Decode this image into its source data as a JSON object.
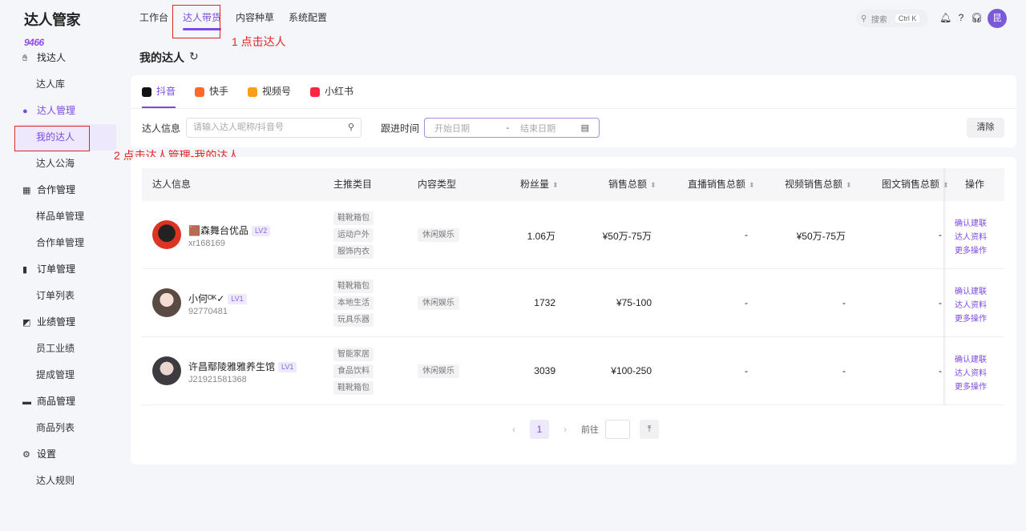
{
  "app": {
    "logo_num": "9466",
    "logo_text": "达人管家"
  },
  "nav": [
    "工作台",
    "达人带货",
    "内容种草",
    "系统配置"
  ],
  "annotations": {
    "step1": "1 点击达人",
    "step2": "2 点击达人管理-我的达人"
  },
  "topbar": {
    "search_label": "搜索",
    "search_kbd": "Ctrl K",
    "avatar": "昆"
  },
  "sidebar": {
    "groups": [
      {
        "label": "找达人",
        "icon": "handshake-icon",
        "items": [
          "达人库"
        ]
      },
      {
        "label": "达人管理",
        "icon": "user-icon",
        "items": [
          "我的达人",
          "达人公海"
        ]
      },
      {
        "label": "合作管理",
        "icon": "grid-icon",
        "items": [
          "样品单管理",
          "合作单管理"
        ]
      },
      {
        "label": "订单管理",
        "icon": "clipboard-icon",
        "items": [
          "订单列表"
        ]
      },
      {
        "label": "业绩管理",
        "icon": "chart-icon",
        "items": [
          "员工业绩",
          "提成管理"
        ]
      },
      {
        "label": "商品管理",
        "icon": "box-icon",
        "items": [
          "商品列表"
        ]
      },
      {
        "label": "设置",
        "icon": "gear-icon",
        "items": [
          "达人规则"
        ]
      }
    ]
  },
  "page": {
    "title": "我的达人"
  },
  "platform_tabs": [
    {
      "label": "抖音",
      "color": "#111111"
    },
    {
      "label": "快手",
      "color": "#ff6a2b"
    },
    {
      "label": "视频号",
      "color": "#fa9d18"
    },
    {
      "label": "小红书",
      "color": "#ff2442"
    }
  ],
  "filters": {
    "info_label": "达人信息",
    "info_placeholder": "请输入达人昵称/抖音号",
    "time_label": "跟进时间",
    "start_placeholder": "开始日期",
    "end_placeholder": "结束日期",
    "clear_label": "清除"
  },
  "table": {
    "headers": [
      "达人信息",
      "主推类目",
      "内容类型",
      "粉丝量",
      "销售总额",
      "直播销售总额",
      "视频销售总额",
      "图文销售总额",
      "操作"
    ],
    "rows": [
      {
        "name": "🟫森舞台优品",
        "level": "LV2",
        "uid": "xr168169",
        "categories": [
          "鞋靴箱包",
          "运动户外",
          "服饰内衣"
        ],
        "content_type": "休闲娱乐",
        "fans": "1.06万",
        "sales": "¥50万-75万",
        "live": "-",
        "video": "¥50万-75万",
        "text": "-"
      },
      {
        "name": "小何ᴼᴷ✓",
        "level": "LV1",
        "uid": "92770481",
        "categories": [
          "鞋靴箱包",
          "本地生活",
          "玩具乐器"
        ],
        "content_type": "休闲娱乐",
        "fans": "1732",
        "sales": "¥75-100",
        "live": "-",
        "video": "-",
        "text": "-"
      },
      {
        "name": "许昌鄢陵雅雅养生馆",
        "level": "LV1",
        "uid": "J21921581368",
        "categories": [
          "智能家居",
          "食品饮料",
          "鞋靴箱包"
        ],
        "content_type": "休闲娱乐",
        "fans": "3039",
        "sales": "¥100-250",
        "live": "-",
        "video": "-",
        "text": "-"
      }
    ],
    "ops": [
      "确认建联",
      "达人资料",
      "更多操作"
    ]
  },
  "pagination": {
    "current": "1",
    "goto_label": "前往"
  }
}
